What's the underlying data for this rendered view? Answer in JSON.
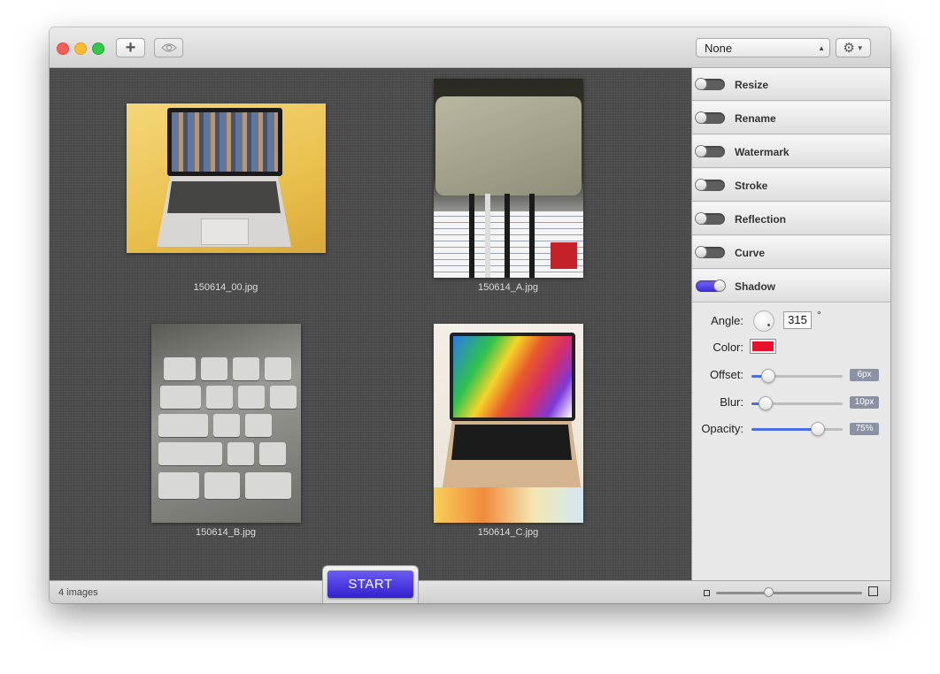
{
  "toolbar": {
    "add_icon": "plus-icon",
    "preview_icon": "eye-icon",
    "preset_value": "None",
    "settings_icon": "gear-icon"
  },
  "images": [
    {
      "filename": "150614_00.jpg"
    },
    {
      "filename": "150614_A.jpg"
    },
    {
      "filename": "150614_B.jpg"
    },
    {
      "filename": "150614_C.jpg"
    }
  ],
  "effects": [
    {
      "label": "Resize",
      "enabled": false
    },
    {
      "label": "Rename",
      "enabled": false
    },
    {
      "label": "Watermark",
      "enabled": false
    },
    {
      "label": "Stroke",
      "enabled": false
    },
    {
      "label": "Reflection",
      "enabled": false
    },
    {
      "label": "Curve",
      "enabled": false
    },
    {
      "label": "Shadow",
      "enabled": true
    }
  ],
  "shadow": {
    "angle_label": "Angle:",
    "angle_value": "315",
    "degree_symbol": "°",
    "color_label": "Color:",
    "color": "#e8102b",
    "offset_label": "Offset:",
    "offset_value": "6px",
    "offset_fraction": 0.18,
    "blur_label": "Blur:",
    "blur_value": "10px",
    "blur_fraction": 0.16,
    "opacity_label": "Opacity:",
    "opacity_value": "75%",
    "opacity_fraction": 0.73
  },
  "status": {
    "image_count": "4 images",
    "start_label": "START",
    "zoom_fraction": 0.36
  },
  "colors": {
    "accent": "#4a3de6",
    "close": "#fc5f57",
    "minimize": "#fdbc2e",
    "zoom": "#33c748"
  }
}
